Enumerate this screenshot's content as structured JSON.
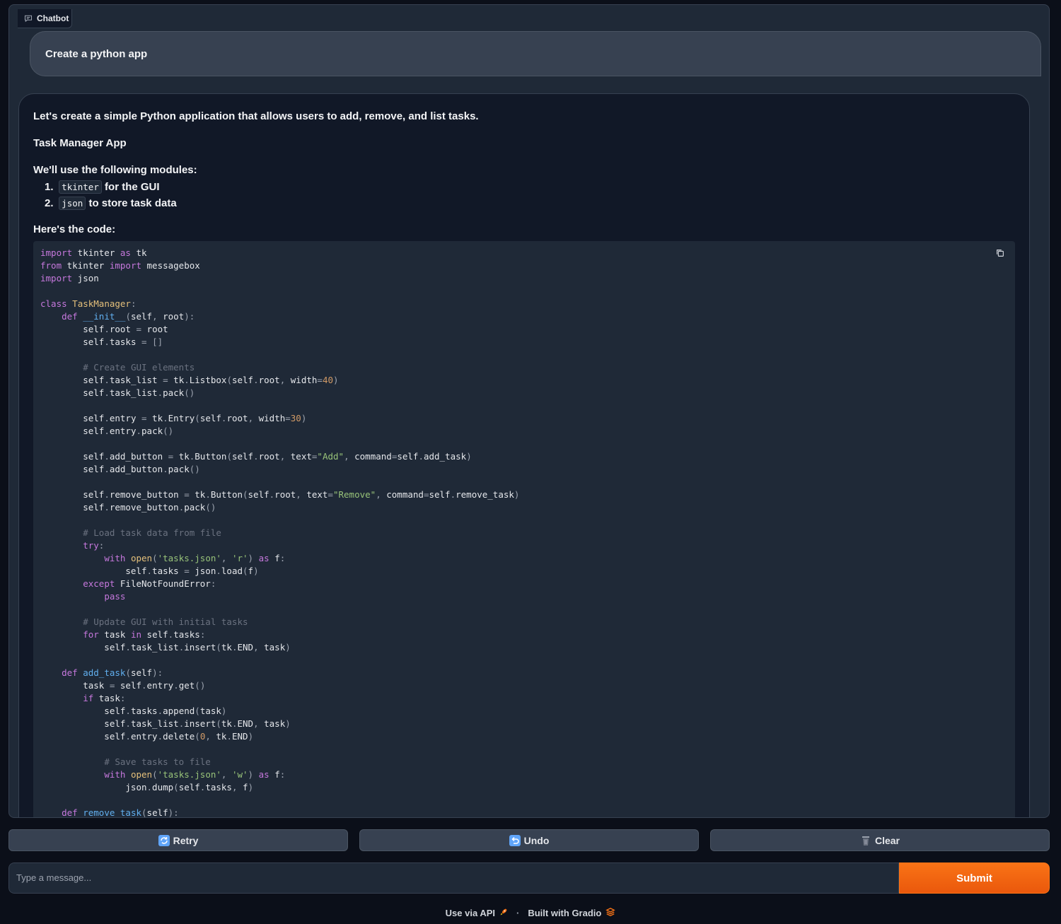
{
  "panel": {
    "label": "Chatbot",
    "icon": "chat-icon"
  },
  "user_message": "Create a python app",
  "bot_message": {
    "intro": "Let's create a simple Python application that allows users to add, remove, and list tasks.",
    "title": "Task Manager App",
    "modules_heading": "We'll use the following modules:",
    "modules": [
      {
        "num": "1.",
        "code": "tkinter",
        "text": "for the GUI"
      },
      {
        "num": "2.",
        "code": "json",
        "text": "to store task data"
      }
    ],
    "code_heading": "Here's the code:",
    "copy_icon": "copy-icon"
  },
  "actions": {
    "retry": {
      "label": "Retry",
      "icon": "refresh-icon"
    },
    "undo": {
      "label": "Undo",
      "icon": "undo-icon"
    },
    "clear": {
      "label": "Clear",
      "icon": "trash-icon"
    }
  },
  "input": {
    "placeholder": "Type a message...",
    "value": ""
  },
  "submit_label": "Submit",
  "footer": {
    "api_label": "Use via API",
    "built_label": "Built with Gradio",
    "separator": "·"
  },
  "colors": {
    "accent": "#f97316",
    "background": "#0b0f19",
    "panel": "#1f2937"
  }
}
